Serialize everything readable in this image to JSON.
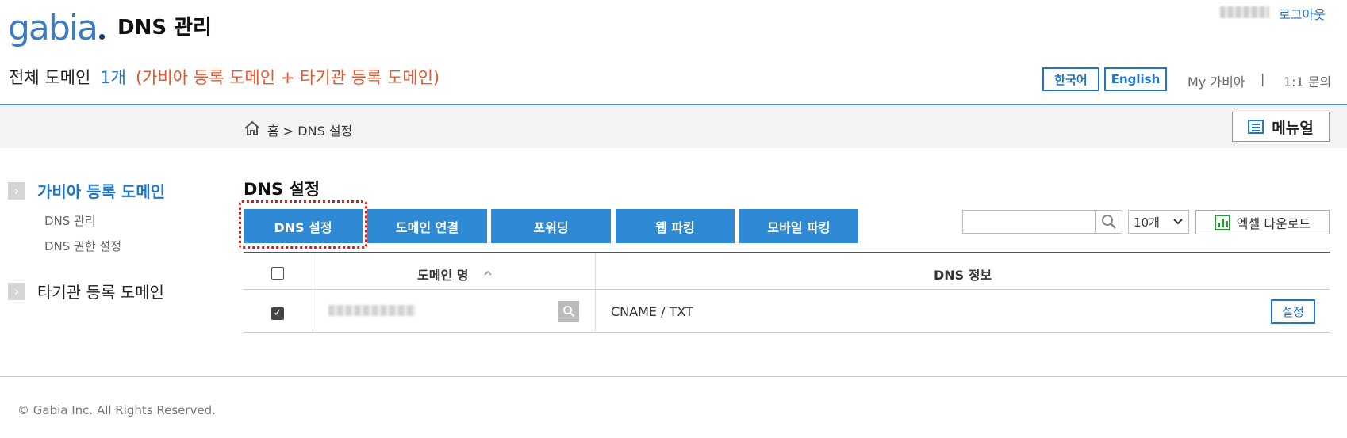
{
  "header": {
    "logo_text": "gabia",
    "app_title": "DNS 관리",
    "logout_label": "로그아웃",
    "domain_summary": {
      "label": "전체 도메인",
      "count": "1개",
      "description": "(가비아 등록 도메인 + 타기관 등록 도메인)"
    },
    "lang_ko": "한국어",
    "lang_en": "English",
    "my_gabia": "My 가비아",
    "separator": "|",
    "inquiry": "1:1 문의"
  },
  "breadcrumb": {
    "text": "홈 > DNS 설정"
  },
  "manual_label": "메뉴얼",
  "sidebar": {
    "gabia_domain": "가비아 등록 도메인",
    "sub_items": [
      "DNS 관리",
      "DNS 권한 설정"
    ],
    "other_domain": "타기관 등록 도메인"
  },
  "main": {
    "section_title": "DNS 설정",
    "tabs": [
      "DNS 설정",
      "도메인 연결",
      "포워딩",
      "웹 파킹",
      "모바일 파킹"
    ],
    "page_size": "10개",
    "excel_label": "엑셀 다운로드",
    "table": {
      "col_domain": "도메인 명",
      "col_dns": "DNS 정보",
      "sort_icon": "chevron-up-icon",
      "rows": [
        {
          "checked": true,
          "dns_info": "CNAME / TXT",
          "action": "설정"
        }
      ]
    }
  },
  "footer": {
    "copyright": "© Gabia Inc. All Rights Reserved."
  },
  "colors": {
    "accent": "#2f8ad6",
    "link": "#1f76c8",
    "highlight": "#e8562e",
    "annotation": "#e01414"
  }
}
